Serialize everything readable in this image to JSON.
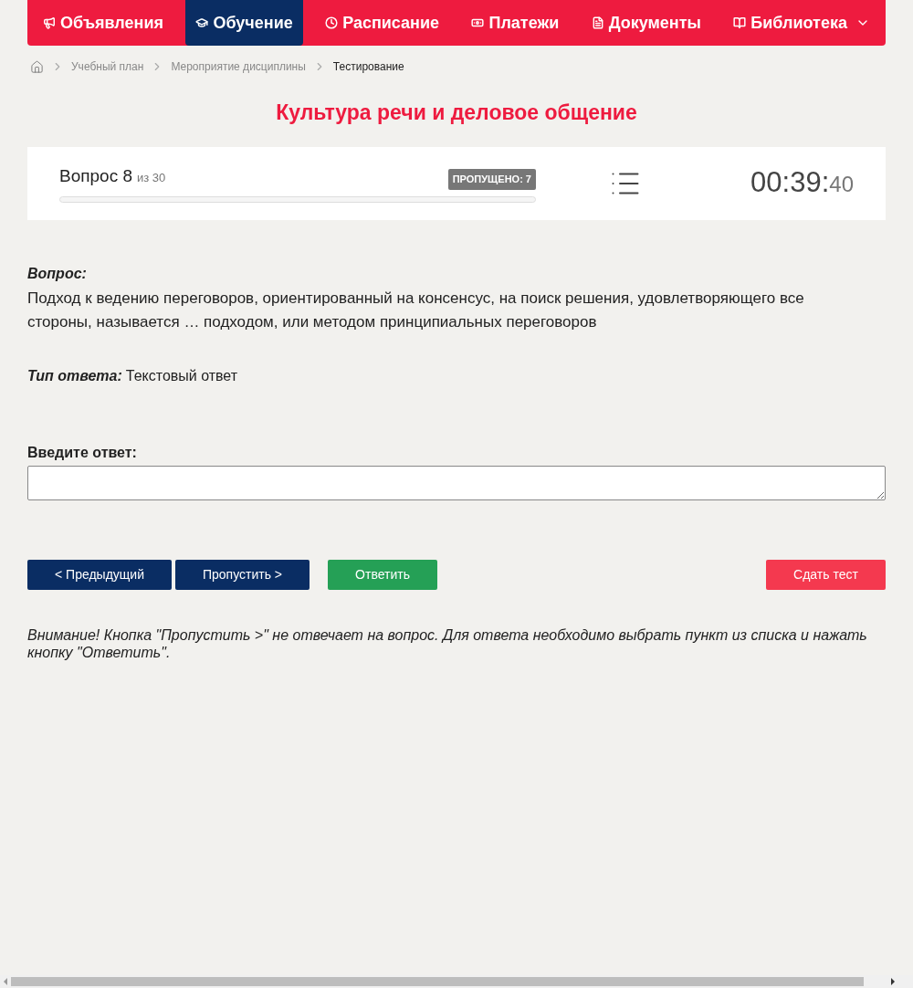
{
  "nav": [
    {
      "label": "Объявления",
      "selected": false
    },
    {
      "label": "Обучение",
      "selected": true
    },
    {
      "label": "Расписание",
      "selected": false
    },
    {
      "label": "Платежи",
      "selected": false
    },
    {
      "label": "Документы",
      "selected": false
    },
    {
      "label": "Библиотека",
      "selected": false,
      "dropdown": true
    }
  ],
  "breadcrumbs": [
    {
      "label": "Учебный план",
      "current": false
    },
    {
      "label": "Мероприятие дисциплины",
      "current": false
    },
    {
      "label": "Тестирование",
      "current": true
    }
  ],
  "title": "Культура речи и деловое общение",
  "progress": {
    "question": "Вопрос 8",
    "of": "из 30",
    "skipped": "ПРОПУЩЕНО: 7",
    "level": 0,
    "timer_main": "00:39:",
    "timer_seconds": "40"
  },
  "question": {
    "label": "Вопрос:",
    "text": "Подход к ведению переговоров, ориентированный на консенсус, на поиск решения, удовлетворяющего все стороны, называется … подходом, или методом принципиальных переговоров"
  },
  "answer_type": {
    "label": "Тип ответа:",
    "value": "Текстовый ответ"
  },
  "answer": {
    "label": "Введите ответ:"
  },
  "buttons": [
    {
      "label": "< Предыдущий",
      "kind": "nav"
    },
    {
      "label": "Пропустить >",
      "kind": "nav"
    },
    {
      "label": "Ответить",
      "kind": "submit"
    },
    {
      "label": "Сдать тест",
      "kind": "finish"
    }
  ],
  "notice": "Внимание! Кнопка \"Пропустить >\" не отвечает на вопрос. Для ответа необходимо выбрать пункт из списка и нажать кнопку \"Ответить\"."
}
